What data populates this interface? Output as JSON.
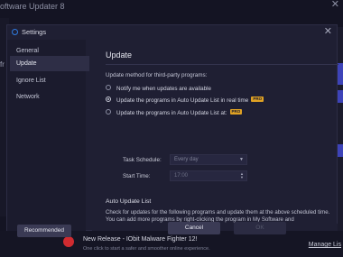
{
  "background": {
    "title": "oftware Updater 8",
    "left_text": "fr",
    "bottom": {
      "title": "New Release - IObit Malware Fighter 12!",
      "subtitle": "One click to start a safer and smoother online experience.",
      "link": "Manage Lis"
    }
  },
  "dialog": {
    "title": "Settings",
    "sidebar": {
      "items": [
        {
          "label": "General"
        },
        {
          "label": "Update"
        },
        {
          "label": "Ignore List"
        },
        {
          "label": "Network"
        }
      ],
      "recommended_label": "Recommended"
    },
    "main": {
      "heading": "Update",
      "method_label": "Update method for third-party programs:",
      "options": [
        {
          "label": "Notify me when updates are available",
          "pro": false,
          "selected": false
        },
        {
          "label": "Update the programs in Auto Update List in real time",
          "pro": true,
          "selected": true
        },
        {
          "label": "Update the programs in Auto Update List at:",
          "pro": true,
          "selected": false
        }
      ],
      "pro_badge": "PRO",
      "schedule_label": "Task Schedule:",
      "schedule_value": "Every day",
      "start_label": "Start Time:",
      "start_value": "17:00",
      "auto_heading": "Auto Update List",
      "auto_text": "Check for updates for the following programs and update them at the above scheduled time. You can add more programs by right-clicking the program in My Software and"
    },
    "buttons": {
      "cancel": "Cancel",
      "ok": "OK"
    }
  },
  "colors": {
    "accent": "#2f7be0",
    "pro_badge": "#e0a224",
    "alert_icon": "#d02b30"
  }
}
